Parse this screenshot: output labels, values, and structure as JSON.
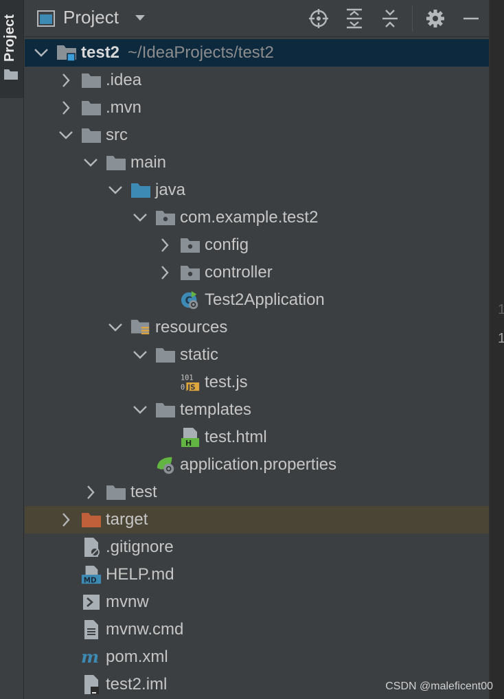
{
  "toolwindow": {
    "strip_label": "Project"
  },
  "header": {
    "title": "Project",
    "buttons": [
      "select-opened-file",
      "expand-all",
      "collapse-all",
      "settings",
      "hide"
    ]
  },
  "tree": [
    {
      "label": "test2",
      "subtext": "~/IdeaProjects/test2",
      "depth": 0,
      "arrow": "down",
      "icon": "module-folder-icon",
      "state": "selected"
    },
    {
      "label": ".idea",
      "depth": 1,
      "arrow": "right",
      "icon": "folder-icon"
    },
    {
      "label": ".mvn",
      "depth": 1,
      "arrow": "right",
      "icon": "folder-icon"
    },
    {
      "label": "src",
      "depth": 1,
      "arrow": "down",
      "icon": "folder-icon"
    },
    {
      "label": "main",
      "depth": 2,
      "arrow": "down",
      "icon": "folder-icon"
    },
    {
      "label": "java",
      "depth": 3,
      "arrow": "down",
      "icon": "source-folder-icon"
    },
    {
      "label": "com.example.test2",
      "depth": 4,
      "arrow": "down",
      "icon": "package-icon"
    },
    {
      "label": "config",
      "depth": 5,
      "arrow": "right",
      "icon": "package-icon"
    },
    {
      "label": "controller",
      "depth": 5,
      "arrow": "right",
      "icon": "package-icon"
    },
    {
      "label": "Test2Application",
      "depth": 5,
      "arrow": "none",
      "icon": "spring-class-icon"
    },
    {
      "label": "resources",
      "depth": 3,
      "arrow": "down",
      "icon": "resources-folder-icon"
    },
    {
      "label": "static",
      "depth": 4,
      "arrow": "down",
      "icon": "folder-icon"
    },
    {
      "label": "test.js",
      "depth": 5,
      "arrow": "none",
      "icon": "js-file-icon"
    },
    {
      "label": "templates",
      "depth": 4,
      "arrow": "down",
      "icon": "folder-icon"
    },
    {
      "label": "test.html",
      "depth": 5,
      "arrow": "none",
      "icon": "html-file-icon"
    },
    {
      "label": "application.properties",
      "depth": 4,
      "arrow": "none",
      "icon": "spring-properties-icon"
    },
    {
      "label": "test",
      "depth": 2,
      "arrow": "right",
      "icon": "folder-icon"
    },
    {
      "label": "target",
      "depth": 1,
      "arrow": "right",
      "icon": "excluded-folder-icon",
      "state": "excluded"
    },
    {
      "label": ".gitignore",
      "depth": 1,
      "arrow": "none",
      "icon": "gitignore-file-icon"
    },
    {
      "label": "HELP.md",
      "depth": 1,
      "arrow": "none",
      "icon": "markdown-file-icon"
    },
    {
      "label": "mvnw",
      "depth": 1,
      "arrow": "none",
      "icon": "shell-file-icon"
    },
    {
      "label": "mvnw.cmd",
      "depth": 1,
      "arrow": "none",
      "icon": "text-file-icon"
    },
    {
      "label": "pom.xml",
      "depth": 1,
      "arrow": "none",
      "icon": "maven-icon"
    },
    {
      "label": "test2.iml",
      "depth": 1,
      "arrow": "none",
      "icon": "iml-file-icon"
    }
  ],
  "editor_gutter": [
    "1",
    "1"
  ],
  "watermark": "CSDN @maleficent00",
  "colors": {
    "panel_bg": "#3c3f41",
    "selected_row": "#0d293e",
    "excluded_row": "#4b4535",
    "folder": "#8a9196",
    "source_folder": "#3d8ab5",
    "excluded_folder": "#c0603a",
    "spring_green": "#62b543"
  }
}
